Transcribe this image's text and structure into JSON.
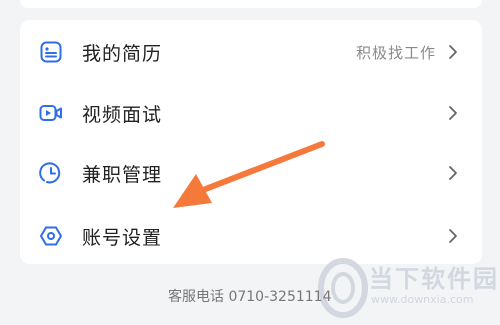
{
  "menu": {
    "items": [
      {
        "label": "我的简历",
        "extra": "积极找工作",
        "icon": "resume-icon"
      },
      {
        "label": "视频面试",
        "extra": "",
        "icon": "video-interview-icon"
      },
      {
        "label": "兼职管理",
        "extra": "",
        "icon": "clock-icon"
      },
      {
        "label": "账号设置",
        "extra": "",
        "icon": "settings-hexagon-icon"
      }
    ]
  },
  "footer": {
    "service_phone": "客服电话 0710-3251114"
  },
  "annotation": {
    "arrow_color": "#f5793b"
  },
  "watermark": {
    "text": "当下软件园",
    "url": "www.downxia.com"
  },
  "colors": {
    "icon_blue": "#2f6ee8",
    "background": "#f3f4f6",
    "card": "#ffffff"
  }
}
